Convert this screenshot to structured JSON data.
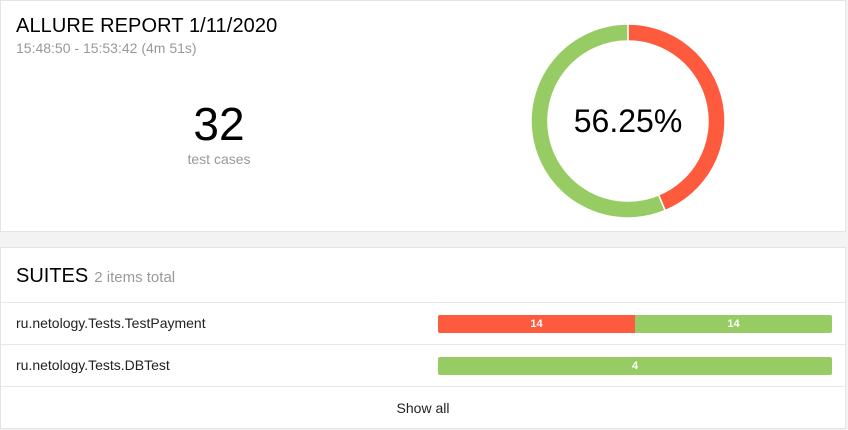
{
  "summary": {
    "title": "ALLURE REPORT 1/11/2020",
    "time_range": "15:48:50 - 15:53:42 (4m 51s)",
    "test_count": "32",
    "test_count_label": "test cases",
    "success_rate": "56.25%",
    "chart_data": {
      "type": "pie",
      "variant": "donut",
      "slices": [
        {
          "status": "failed",
          "value": 14,
          "color": "#fd5a3e"
        },
        {
          "status": "passed",
          "value": 18,
          "color": "#97cc64"
        }
      ]
    }
  },
  "suites": {
    "title": "SUITES",
    "count_text": "2 items total",
    "items": [
      {
        "name": "ru.netology.Tests.TestPayment",
        "segments": [
          {
            "status": "failed",
            "label": "14",
            "value": 14,
            "color": "#fd5a3e"
          },
          {
            "status": "passed",
            "label": "14",
            "value": 14,
            "color": "#97cc64"
          }
        ]
      },
      {
        "name": "ru.netology.Tests.DBTest",
        "segments": [
          {
            "status": "passed",
            "label": "4",
            "value": 4,
            "color": "#97cc64"
          }
        ]
      }
    ],
    "show_all_label": "Show all"
  }
}
